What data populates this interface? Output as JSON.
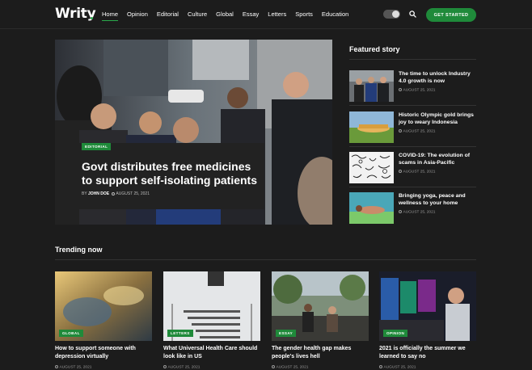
{
  "header": {
    "logo": "Writy",
    "nav": [
      "Home",
      "Opinion",
      "Editorial",
      "Culture",
      "Global",
      "Essay",
      "Letters",
      "Sports",
      "Education"
    ],
    "active_nav": "Home",
    "cta": "GET STARTED"
  },
  "hero": {
    "badge": "EDITORIAL",
    "title": "Govt distributes free medicines to support self-isolating patients",
    "by": "BY",
    "author": "JOHN DOE",
    "date": "AUGUST 25, 2021"
  },
  "featured": {
    "title": "Featured story",
    "items": [
      {
        "title": "The time to unlock Industry 4.0 growth is now",
        "date": "AUGUST 25, 2021"
      },
      {
        "title": "Historic Olympic gold brings joy to weary Indonesia",
        "date": "AUGUST 25, 2021"
      },
      {
        "title": "COVID-19: The evolution of scams in Asia-Pacific",
        "date": "AUGUST 25, 2021"
      },
      {
        "title": "Bringing yoga, peace and wellness to your home",
        "date": "AUGUST 25, 2021"
      }
    ]
  },
  "trending": {
    "title": "Trending now",
    "cards": [
      {
        "badge": "GLOBAL",
        "title": "How to support someone with depression virtually",
        "date": "AUGUST 25, 2021"
      },
      {
        "badge": "LETTERS",
        "title": "What Universal Health Care should look like in US",
        "date": "AUGUST 25, 2021"
      },
      {
        "badge": "ESSAY",
        "title": "The gender health gap makes people's lives hell",
        "date": "AUGUST 25, 2021"
      },
      {
        "badge": "OPINION",
        "title": "2021 is officially the summer we learned to say no",
        "date": "AUGUST 25, 2021"
      }
    ]
  },
  "colors": {
    "accent": "#1f8a3a",
    "background": "#1c1c1c"
  }
}
